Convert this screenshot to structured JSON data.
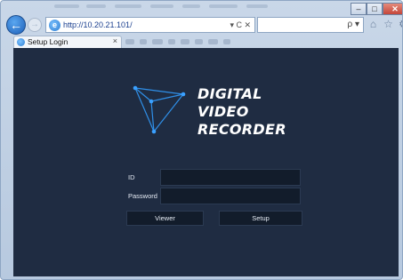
{
  "browser": {
    "back_icon": "back-arrow-icon",
    "forward_icon": "forward-arrow-icon",
    "address": "http://10.20.21.101/",
    "address_controls": "▾ C ✕",
    "search_controls": "ρ ▾",
    "tools": [
      "home-icon",
      "star-icon",
      "gear-icon"
    ],
    "window_controls": {
      "minimize": "–",
      "maximize": "□",
      "close": "✕"
    }
  },
  "tab": {
    "label": "Setup Login",
    "close": "×"
  },
  "logo": {
    "line1": "DIGITAL",
    "line2": "VIDEO",
    "line3": "RECORDER",
    "accent": "#2f8fe8"
  },
  "login": {
    "id_label": "ID",
    "password_label": "Password",
    "id_value": "",
    "password_value": "",
    "viewer_button": "Viewer",
    "setup_button": "Setup"
  },
  "colors": {
    "background": "#1f2c42",
    "input_bg": "#121c2b"
  }
}
